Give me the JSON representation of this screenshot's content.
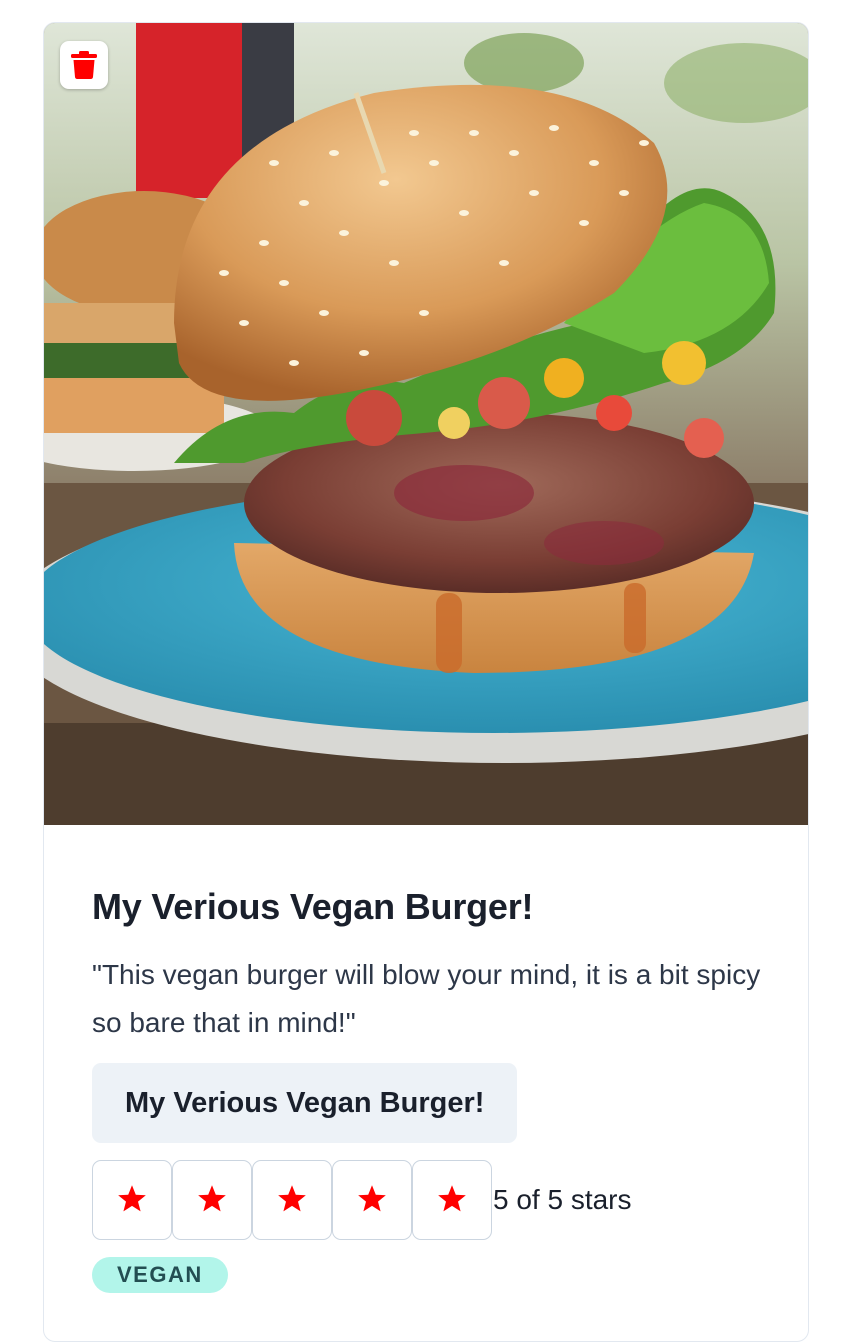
{
  "card": {
    "image_alt": "Vegan burger with sesame bun, lettuce and salsa on a blue plate",
    "delete_icon": "trash-icon",
    "title": "My Verious Vegan Burger!",
    "description": "\"This vegan burger will blow your mind, it is a bit spicy so bare that in mind!\"",
    "name_button_label": "My Verious Vegan Burger!",
    "rating": {
      "value": 5,
      "max": 5,
      "star_icon": "star-icon",
      "star_color": "#ff0000",
      "label": "5 of 5 stars"
    },
    "tag": "VEGAN"
  },
  "colors": {
    "delete_icon": "#ff0000",
    "badge_bg": "#b2f5ea",
    "badge_text": "#234e52",
    "button_bg": "#edf2f7"
  }
}
